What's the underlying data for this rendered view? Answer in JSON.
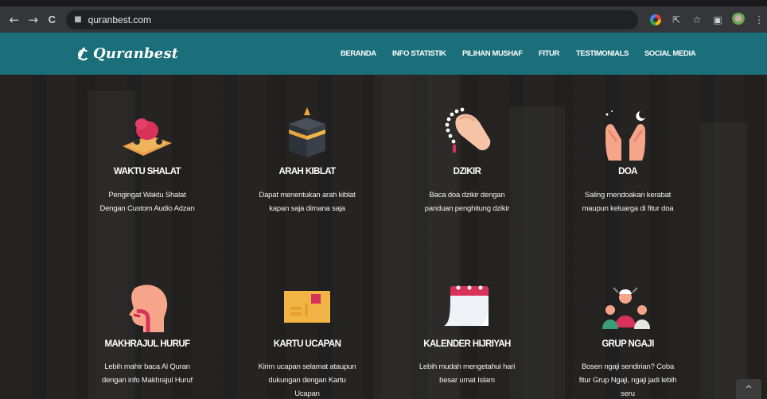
{
  "browser": {
    "url": "quranbest.com",
    "icons": {
      "back": "←",
      "forward": "→",
      "reload": "C",
      "lock": "🔒",
      "share": "⇱",
      "star": "☆",
      "sidepanel": "▣",
      "menu": "⋮"
    }
  },
  "site": {
    "logo_text": "Quranbest",
    "nav": [
      "BERANDA",
      "INFO STATISTIK",
      "PILIHAN MUSHAF",
      "FITUR",
      "TESTIMONIALS",
      "SOCIAL MEDIA"
    ],
    "brand_color": "#1a6f7b",
    "scroll_top_icon": "^"
  },
  "features": [
    {
      "icon": "prayer-mat-icon",
      "title": "WAKTU SHALAT",
      "desc": [
        "Pengingat Waktu Shalat",
        "Dengan Custom Audio Adzan"
      ]
    },
    {
      "icon": "kaaba-icon",
      "title": "ARAH KIBLAT",
      "desc": [
        "Dapat menentukan arah kiblat",
        "kapan saja dimana saja"
      ]
    },
    {
      "icon": "prayer-beads-icon",
      "title": "DZIKIR",
      "desc": [
        "Baca doa dzikir dengan",
        "panduan penghitung dzikir"
      ]
    },
    {
      "icon": "praying-hands-icon",
      "title": "DOA",
      "desc": [
        "Saling mendoakan kerabat",
        "maupun keluarga di fitur doa"
      ]
    },
    {
      "icon": "head-profile-icon",
      "title": "MAKHRAJUL HURUF",
      "desc": [
        "Lebih mahir baca Al Quran",
        "dengan info Makhrajul Huruf"
      ]
    },
    {
      "icon": "greeting-card-icon",
      "title": "KARTU UCAPAN",
      "desc": [
        "Kirim ucapan selamat ataupun",
        "dukungan dengan Kartu",
        "Ucapan"
      ]
    },
    {
      "icon": "calendar-icon",
      "title": "KALENDER HIJRIYAH",
      "desc": [
        "Lebih mudah mengetahui hari",
        "besar umat Islam"
      ]
    },
    {
      "icon": "group-people-icon",
      "title": "GRUP NGAJI",
      "desc": [
        "Bosen ngaji sendirian? Coba",
        "fitur Grup Ngaji, ngaji jadi lebih",
        "seru"
      ]
    }
  ]
}
